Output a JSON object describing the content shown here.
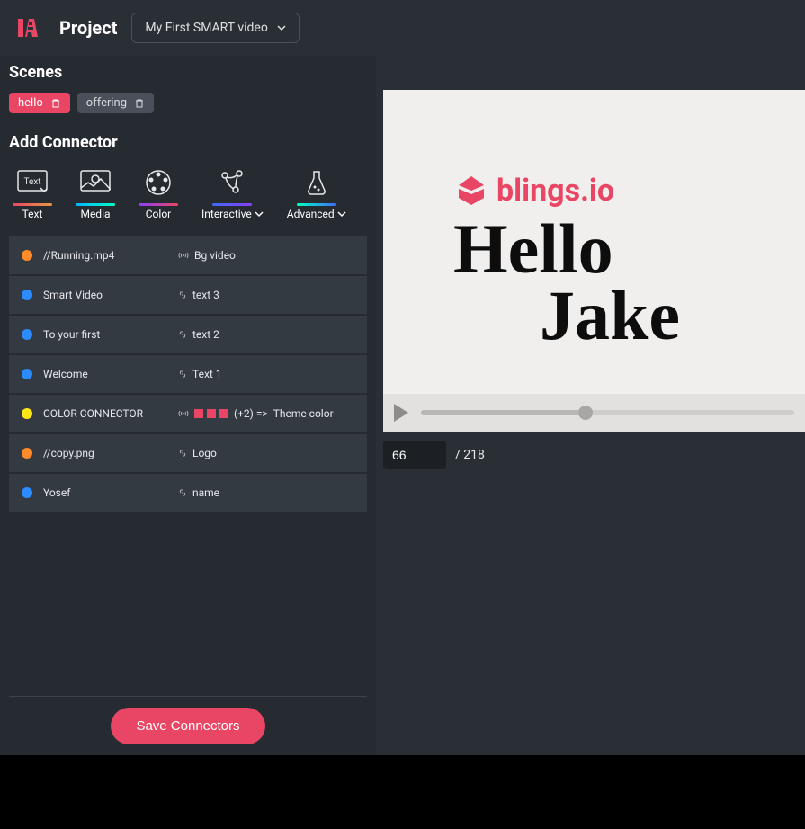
{
  "header": {
    "project_label": "Project",
    "project_name": "My First SMART video"
  },
  "sidebar": {
    "scenes_title": "Scenes",
    "scenes": [
      {
        "label": "hello",
        "active": true
      },
      {
        "label": "offering",
        "active": false
      }
    ],
    "add_connector_title": "Add Connector",
    "types": [
      {
        "label": "Text",
        "has_chevron": false
      },
      {
        "label": "Media",
        "has_chevron": false
      },
      {
        "label": "Color",
        "has_chevron": false
      },
      {
        "label": "Interactive",
        "has_chevron": true
      },
      {
        "label": "Advanced",
        "has_chevron": true
      }
    ],
    "connectors": [
      {
        "dot": "orange",
        "name": "//Running.mp4",
        "target": "Bg video",
        "icon": "broadcast"
      },
      {
        "dot": "blue",
        "name": "Smart Video",
        "target": "text 3",
        "icon": "link"
      },
      {
        "dot": "blue",
        "name": "To your first",
        "target": "text 2",
        "icon": "link"
      },
      {
        "dot": "blue",
        "name": "Welcome",
        "target": "Text 1",
        "icon": "link"
      },
      {
        "dot": "yellow",
        "name": "COLOR CONNECTOR",
        "target": "Theme color",
        "icon": "broadcast",
        "extra": "(+2)  =>"
      },
      {
        "dot": "orange",
        "name": "//copy.png",
        "target": "Logo",
        "icon": "link"
      },
      {
        "dot": "blue",
        "name": "Yosef",
        "target": "name",
        "icon": "link"
      }
    ],
    "save_label": "Save Connectors"
  },
  "preview": {
    "brand_text": "blings.io",
    "hero_line1": "Hello",
    "hero_line2": "Jake",
    "current_frame": "66",
    "total_frames": "/ 218"
  },
  "colors": {
    "accent": "#e84664",
    "orange": "#ff8b2b",
    "blue": "#2b8bff",
    "yellow": "#ffe716"
  }
}
